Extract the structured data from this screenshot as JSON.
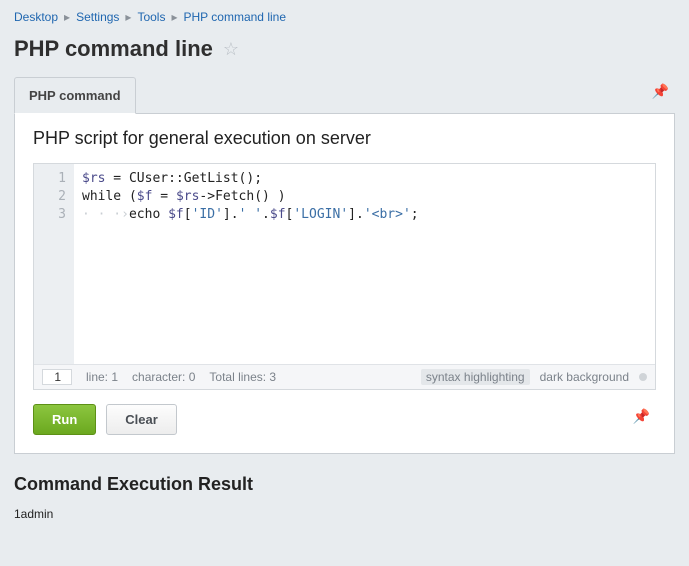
{
  "breadcrumb": [
    {
      "label": "Desktop"
    },
    {
      "label": "Settings"
    },
    {
      "label": "Tools"
    },
    {
      "label": "PHP command line"
    }
  ],
  "page_title": "PHP command line",
  "tab_label": "PHP command",
  "panel_heading": "PHP script for general execution on server",
  "code": {
    "lines": [
      "1",
      "2",
      "3"
    ],
    "line1_raw": "$rs = CUser::GetList();",
    "line2_raw": "while ($f = $rs->Fetch() )",
    "line3_raw": "    echo $f['ID'].' '.$f['LOGIN'].'<br>';"
  },
  "status": {
    "current_line": "1",
    "line_label": "line: 1",
    "char_label": "character: 0",
    "total_label": "Total lines: 3",
    "syntax_link": "syntax highlighting",
    "dark_bg_link": "dark background"
  },
  "buttons": {
    "run": "Run",
    "clear": "Clear"
  },
  "result_heading": "Command Execution Result",
  "result_output": "1admin"
}
